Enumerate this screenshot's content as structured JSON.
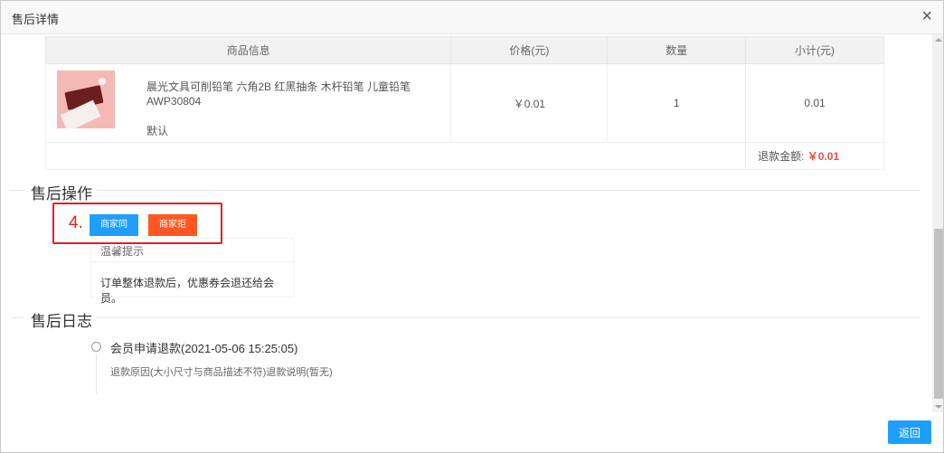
{
  "dialog": {
    "title": "售后详情",
    "close_icon": "×"
  },
  "table": {
    "headers": [
      "商品信息",
      "价格(元)",
      "数量",
      "小计(元)"
    ],
    "product": {
      "name": "晨光文具可削铅笔 六角2B 红黑抽条 木杆铅笔 儿童铅笔AWP30804",
      "sku": "默认",
      "price": "￥0.01",
      "quantity": "1",
      "subtotal": "0.01"
    },
    "refund_label": "退款金额: ",
    "refund_value": "￥0.01"
  },
  "after_sale_ops": {
    "heading": "售后操作",
    "step_label": "4.",
    "agree_label": "商家同意",
    "refuse_label": "商家拒绝",
    "tip_title": "温馨提示",
    "tip_text": "订单整体退款后，优惠券会退还给会员。"
  },
  "after_sale_log": {
    "heading": "售后日志",
    "entries": [
      {
        "title": "会员申请退款(2021-05-06 15:25:05)",
        "desc": "退款原因(大小尺寸与商品描述不符)退款说明(暂无)"
      }
    ]
  },
  "footer": {
    "back_label": "返回"
  },
  "colors": {
    "primary": "#1e9fff",
    "danger": "#ff5722",
    "highlight": "#e02020",
    "price_red": "#f24c3d"
  }
}
